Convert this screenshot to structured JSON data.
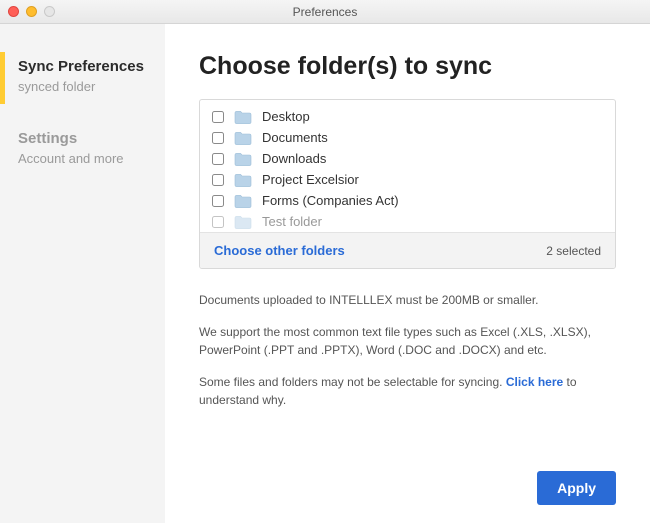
{
  "window": {
    "title": "Preferences"
  },
  "sidebar": {
    "items": [
      {
        "title": "Sync Preferences",
        "sub": "synced folder",
        "active": true
      },
      {
        "title": "Settings",
        "sub": "Account and more",
        "active": false
      }
    ]
  },
  "main": {
    "heading": "Choose folder(s) to sync",
    "folders": [
      {
        "name": "Desktop"
      },
      {
        "name": "Documents"
      },
      {
        "name": "Downloads"
      },
      {
        "name": "Project Excelsior"
      },
      {
        "name": "Forms (Companies Act)"
      },
      {
        "name": "Test folder"
      }
    ],
    "choose_other": "Choose other folders",
    "selected_count": "2 selected",
    "info_para1": "Documents uploaded to INTELLLEX must be 200MB or smaller.",
    "info_para2": "We support the most common text file types such as Excel (.XLS, .XLSX), PowerPoint (.PPT and .PPTX), Word (.DOC and .DOCX) and etc.",
    "info_para3_a": "Some files and folders may not be selectable for syncing. ",
    "info_para3_link": "Click here",
    "info_para3_b": " to understand why.",
    "apply": "Apply"
  }
}
